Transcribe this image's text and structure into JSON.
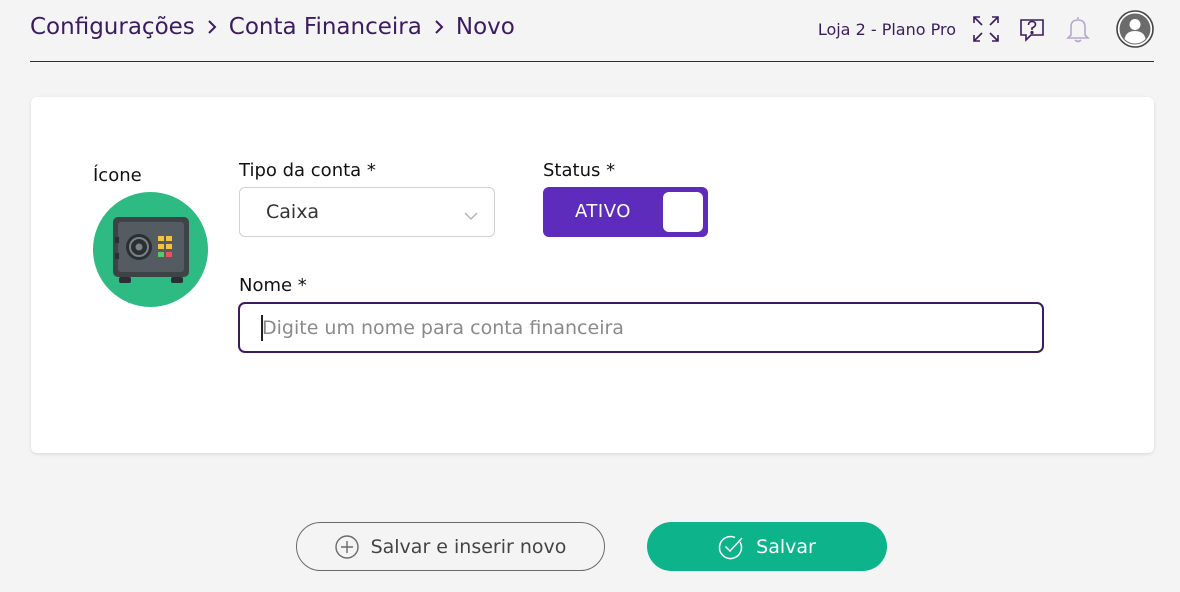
{
  "breadcrumb": {
    "items": [
      "Configurações",
      "Conta Financeira",
      "Novo"
    ]
  },
  "header": {
    "store_plan": "Loja 2 - Plano Pro",
    "icons": [
      "fullscreen-icon",
      "help-chat-icon",
      "bell-icon",
      "user-avatar-icon"
    ]
  },
  "form": {
    "icon_label": "Ícone",
    "account_type_label": "Tipo da conta *",
    "account_type_value": "Caixa",
    "status_label": "Status *",
    "status_value": "ATIVO",
    "name_label": "Nome *",
    "name_placeholder": "Digite um nome para conta financeira",
    "name_value": ""
  },
  "actions": {
    "save_and_new": "Salvar e inserir novo",
    "save": "Salvar"
  },
  "colors": {
    "brand_purple": "#3b1c5e",
    "toggle_purple": "#5e2cbd",
    "primary_green": "#0db48b",
    "icon_green": "#2dba83"
  }
}
